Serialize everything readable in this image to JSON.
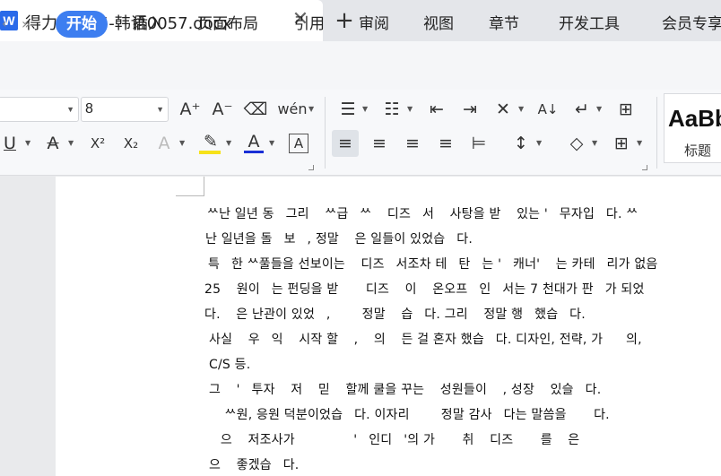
{
  "window": {
    "tab_title": "得力15165-韩语0057.docx",
    "doc_icon_glyph": "W",
    "close_glyph": "✕",
    "new_tab_glyph": "+"
  },
  "menu": {
    "left_chevron": "‹",
    "double_chevron": "»",
    "items": [
      "开始",
      "插入",
      "页面布局",
      "引用",
      "审阅",
      "视图",
      "章节",
      "开发工具",
      "会员专享"
    ],
    "active_index": 0,
    "accent_color": "#3d7ef0"
  },
  "toolbar": {
    "font_name_value": "",
    "font_size_value": "8",
    "grow_font": "A⁺",
    "shrink_font": "A⁻",
    "clear_format": "⌫",
    "phonetic": "wén",
    "bullets": "☰",
    "numbering": "☷",
    "outdent": "⇤",
    "indent": "⇥",
    "chinese_layout": "✕",
    "sort": "A↓",
    "line_direction": "↵",
    "grid_lines": "⊞",
    "underline": "U",
    "strikethrough": "A",
    "superscript": "X²",
    "subscript": "X₂",
    "text_effect": "A",
    "highlight": "✎",
    "font_color": "A",
    "char_border": "A",
    "align_left": "≡",
    "align_center": "≡",
    "align_right": "≡",
    "justify": "≡",
    "distribute": "⊨",
    "line_spacing": "↕",
    "shading": "◇",
    "borders": "⊞",
    "style_preview": "AaBb",
    "style_name": "标题",
    "highlight_color": "#f6e21a",
    "font_color_bar": "#1a2fd6"
  },
  "document": {
    "lines": [
      "ᄊ난 일년 동ᅟ그리ᅟ ᄊ급ᅟᄊ ᅟ디즈ᅟ서 ᅟ사탕을 받ᅟ 있는 'ᅟ무자입ᅟ다. ᄊ",
      "난 일년을 돌ᅟ보ᅟ, 정말 ᅟ은 일들이 있었습ᅟ다.",
      "특ᅟ한 ᄊ풀들을 선보이는 ᅟ디즈ᅟ서조차 테ᅟ탄ᅟ는 'ᅟ캐너' ᅟ는 카테ᅟ리가 없음",
      "25 ᅟ원이ᅟ는 펀딩을 받ᅟ ᅟ디즈ᅟ 이ᅟ 온오프ᅟ인ᅟ서는 7 천대가 판ᅟ가 되었",
      "다. ᅟ은 난관이 있었ᅟ, ᅟᅟ 정말 ᅟ습ᅟ다. 그리ᅟ 정말 행ᅟ했습ᅟ다.",
      "사실 ᅟ우ᅟ익ᅟ 시작 할 ᅟ, ᅟ의 ᅟ든 걸 혼자 했습ᅟ다. 디자인, 전략, 가ᅟᅟ의,",
      "C/S 등.",
      "그ᅟ 'ᅟ투자ᅟ 저ᅟ 믿ᅟ 할께 쿨을 꾸는 ᅟ성원들이 ᅟ, 성장ᅟ 있슬ᅟ다. ᅟ",
      "ᅟ ᄊ원, 응원 덕분이었습ᅟ다. 이자리ᅟ ᅟ 정말 감사ᅟ다는 말씀을 ᅟᅟ다.",
      "ᅟ으ᅟ 저조사가 ᅟᅟ ᅟᅟ 'ᅟ인디ᅟ'의 가ᅟ ᅟ취 ᅟ디즈ᅟ ᅟ를 ᅟ은",
      "으ᅟ 좋겠습ᅟ다."
    ]
  }
}
